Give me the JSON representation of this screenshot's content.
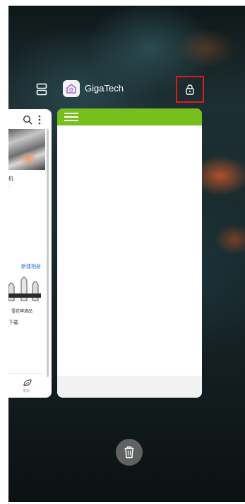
{
  "header": {
    "app_title": "GigaTech",
    "icons": {
      "left": "view-toggle-icon",
      "app": "home-app-icon",
      "lock": "lock-icon"
    }
  },
  "recent_apps": {
    "left_card": {
      "text_line1": "机",
      "text_line2": ".",
      "link_text": "新建相册",
      "caption": "雪花啤酒品",
      "download_text": "下载",
      "nav_label": "发现",
      "icons": [
        "search-icon",
        "more-vert-icon",
        "leaf-icon"
      ]
    },
    "main_card": {
      "app_name": "GigaTech",
      "icons": [
        "hamburger-menu-icon"
      ]
    }
  },
  "actions": {
    "clear_all_icon": "trash-icon"
  },
  "colors": {
    "accent_green": "#76bf1c",
    "highlight_red": "#e01919",
    "link_blue": "#2a6fd6"
  }
}
